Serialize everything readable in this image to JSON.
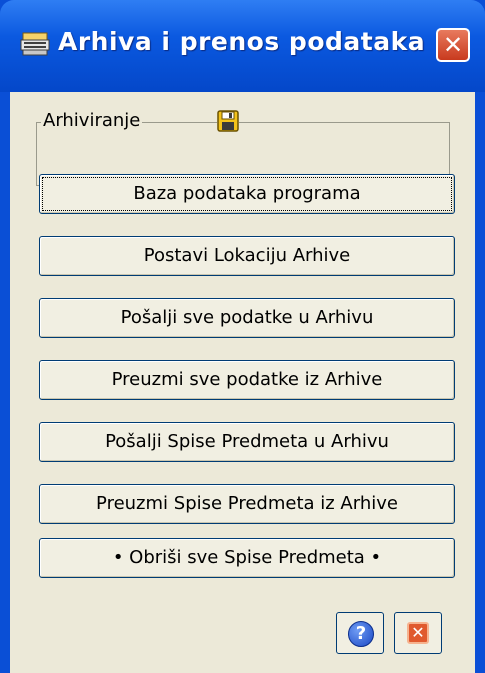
{
  "window": {
    "title": "Arhiva i prenos podataka",
    "close_glyph": "✕"
  },
  "group": {
    "label": "Arhiviranje",
    "icon": "floppy-disk-icon"
  },
  "buttons": [
    {
      "label": "Baza podataka programa",
      "focused": true
    },
    {
      "label": "Postavi Lokaciju Arhive",
      "focused": false
    },
    {
      "label": "Pošalji sve podatke u Arhivu",
      "focused": false
    },
    {
      "label": "Preuzmi sve podatke iz Arhive",
      "focused": false
    },
    {
      "label": "Pošalji Spise Predmeta u Arhivu",
      "focused": false
    },
    {
      "label": "Preuzmi Spise Predmeta iz Arhive",
      "focused": false
    },
    {
      "label": "• Obriši sve Spise Predmeta •",
      "focused": false
    }
  ],
  "bottom": {
    "help_glyph": "?",
    "close_glyph": "✕"
  },
  "colors": {
    "titlebar": "#0b59e0",
    "close": "#c83a1e",
    "face": "#ece9d8"
  }
}
